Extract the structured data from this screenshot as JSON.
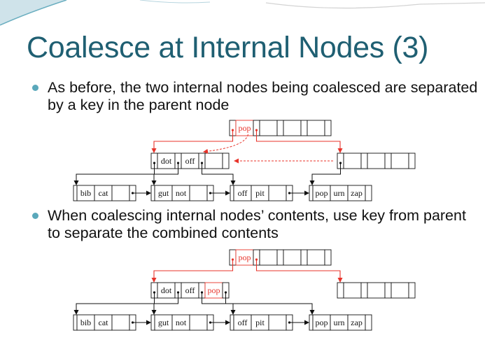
{
  "slide": {
    "title": "Coalesce at Internal Nodes (3)",
    "bullets": [
      "As before, the two internal nodes being coalesced are separated by a key in the parent node",
      "When coalescing internal nodes’ contents, use key from parent to separate the combined contents"
    ],
    "colors": {
      "title": "#1f5f72",
      "bullet": "#5aa8bb",
      "highlight": "#e8332a"
    }
  },
  "diagram1": {
    "parent_key": "pop",
    "left_internal_keys": [
      "dot",
      "off"
    ],
    "right_internal_keys": [],
    "leaves": [
      [
        "bib",
        "cat"
      ],
      [
        "gut",
        "not"
      ],
      [
        "off",
        "pit"
      ],
      [
        "pop",
        "urn",
        "zap"
      ]
    ]
  },
  "diagram2": {
    "parent_key": "pop",
    "left_internal_keys": [
      "dot",
      "off",
      "pop"
    ],
    "right_internal_keys": [],
    "leaves": [
      [
        "bib",
        "cat"
      ],
      [
        "gut",
        "not"
      ],
      [
        "off",
        "pit"
      ],
      [
        "pop",
        "urn",
        "zap"
      ]
    ]
  }
}
